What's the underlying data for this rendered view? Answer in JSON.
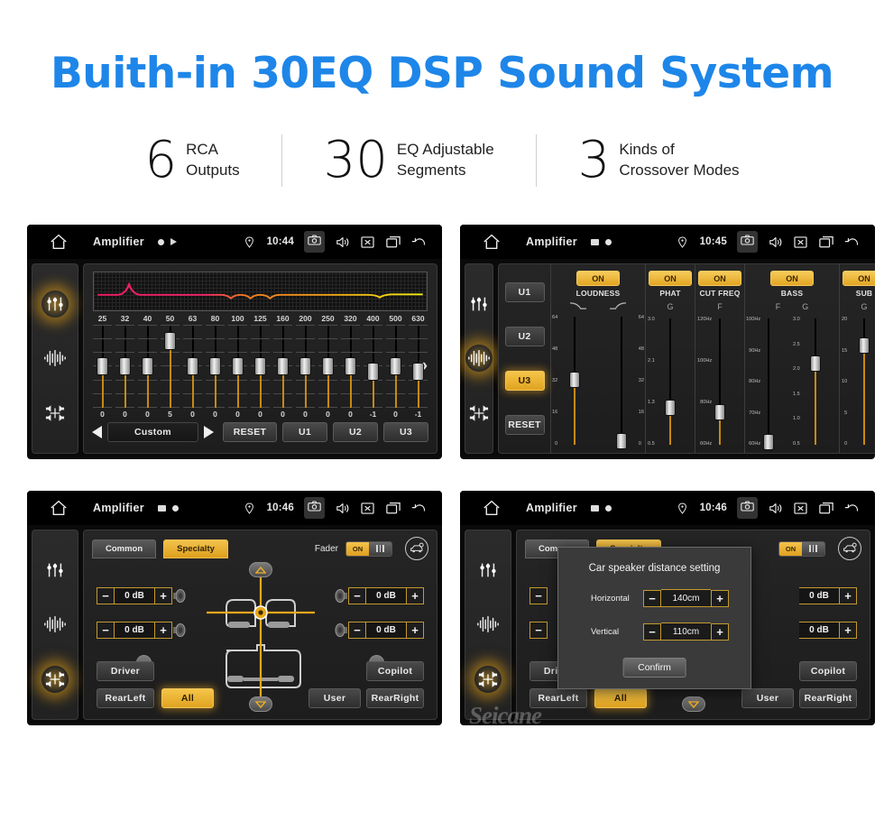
{
  "header": {
    "headline": "Buith-in 30EQ DSP Sound System",
    "stats": [
      {
        "number": "6",
        "line1": "RCA",
        "line2": "Outputs"
      },
      {
        "number": "30",
        "line1": "EQ Adjustable",
        "line2": "Segments"
      },
      {
        "number": "3",
        "line1": "Kinds of",
        "line2": "Crossover Modes"
      }
    ]
  },
  "colors": {
    "headline": "#1E86E8",
    "accent_gold": "#E0A320",
    "screen_bg": "#1d1d1d",
    "statusbar_bg": "#000000"
  },
  "screens": {
    "eq": {
      "statusbar": {
        "title": "Amplifier",
        "time": "10:44",
        "icons": [
          "home-icon",
          "record-dot-icon",
          "play-icon",
          "location-icon",
          "camera-icon",
          "volume-icon",
          "close-icon",
          "recents-icon",
          "back-icon"
        ]
      },
      "sidebar": [
        {
          "name": "equalizer-icon",
          "active": true
        },
        {
          "name": "waveform-icon",
          "active": false
        },
        {
          "name": "balance-icon",
          "active": false
        }
      ],
      "frequencies": [
        "25",
        "32",
        "40",
        "50",
        "63",
        "80",
        "100",
        "125",
        "160",
        "200",
        "250",
        "320",
        "400",
        "500",
        "630"
      ],
      "values": [
        "0",
        "0",
        "0",
        "5",
        "0",
        "0",
        "0",
        "0",
        "0",
        "0",
        "0",
        "0",
        "-1",
        "0",
        "-1"
      ],
      "preset_label": "Custom",
      "reset_label": "RESET",
      "user_presets": [
        "U1",
        "U2",
        "U3"
      ],
      "next_page_icon": "chevron-double-right-icon"
    },
    "crossover": {
      "statusbar": {
        "title": "Amplifier",
        "time": "10:45"
      },
      "sidebar": [
        {
          "name": "equalizer-icon",
          "active": false
        },
        {
          "name": "waveform-icon",
          "active": true
        },
        {
          "name": "balance-icon",
          "active": false
        }
      ],
      "presets": [
        "U1",
        "U2",
        "U3"
      ],
      "selected_preset": "U3",
      "reset_label": "RESET",
      "sections": [
        {
          "label": "LOUDNESS",
          "state": "ON",
          "sliders": [
            {
              "axis": "curve-down-icon",
              "scale": [
                "64",
                "48",
                "32",
                "16",
                "0"
              ],
              "value_pos": 0.5
            },
            {
              "axis": "curve-up-icon",
              "scale": [
                "64",
                "48",
                "32",
                "16",
                "0"
              ],
              "value_pos": 0.05
            }
          ]
        },
        {
          "label": "PHAT",
          "state": "ON",
          "sliders": [
            {
              "axis": "G",
              "scale": [
                "3.0",
                "2.1",
                "1.3",
                "0.5"
              ],
              "value_pos": 0.3
            }
          ]
        },
        {
          "label": "CUT FREQ",
          "state": "ON",
          "sliders": [
            {
              "axis": "F",
              "scale": [
                "120Hz",
                "100Hz",
                "80Hz",
                "60Hz"
              ],
              "value_pos": 0.27
            }
          ]
        },
        {
          "label": "BASS",
          "state": "ON",
          "sliders": [
            {
              "axis": "F",
              "scale": [
                "100Hz",
                "90Hz",
                "80Hz",
                "70Hz",
                "60Hz"
              ],
              "value_pos": 0.05
            },
            {
              "axis": "G",
              "scale": [
                "3.0",
                "2.5",
                "2.0",
                "1.5",
                "1.0",
                "0.5"
              ],
              "value_pos": 0.63
            }
          ]
        },
        {
          "label": "SUB",
          "state": "ON",
          "sliders": [
            {
              "axis": "G",
              "scale": [
                "20",
                "15",
                "10",
                "5",
                "0"
              ],
              "value_pos": 0.76
            }
          ]
        }
      ]
    },
    "fader": {
      "statusbar": {
        "title": "Amplifier",
        "time": "10:46"
      },
      "sidebar": [
        {
          "name": "equalizer-icon",
          "active": false
        },
        {
          "name": "waveform-icon",
          "active": false
        },
        {
          "name": "balance-icon",
          "active": true
        }
      ],
      "tabs": [
        {
          "label": "Common",
          "selected": false
        },
        {
          "label": "Specialty",
          "selected": true
        }
      ],
      "fader_label": "Fader",
      "fader_state": "ON",
      "car_settings_icon": "car-settings-icon",
      "db_controls": [
        {
          "position": "front-left",
          "value": "0 dB"
        },
        {
          "position": "rear-left",
          "value": "0 dB"
        },
        {
          "position": "front-right",
          "value": "0 dB"
        },
        {
          "position": "rear-right",
          "value": "0 dB"
        }
      ],
      "minus_label": "−",
      "plus_label": "+",
      "position_buttons": {
        "driver": "Driver",
        "copilot": "Copilot",
        "rear_left": "RearLeft",
        "all": "All",
        "user": "User",
        "rear_right": "RearRight"
      },
      "selected_position": "All"
    },
    "dialog_screen": {
      "statusbar": {
        "title": "Amplifier",
        "time": "10:46"
      },
      "dialog": {
        "title": "Car speaker distance setting",
        "rows": [
          {
            "label": "Horizontal",
            "value": "140cm"
          },
          {
            "label": "Vertical",
            "value": "110cm"
          }
        ],
        "confirm_label": "Confirm",
        "minus_label": "−",
        "plus_label": "+"
      },
      "watermark": "Seicane"
    }
  }
}
